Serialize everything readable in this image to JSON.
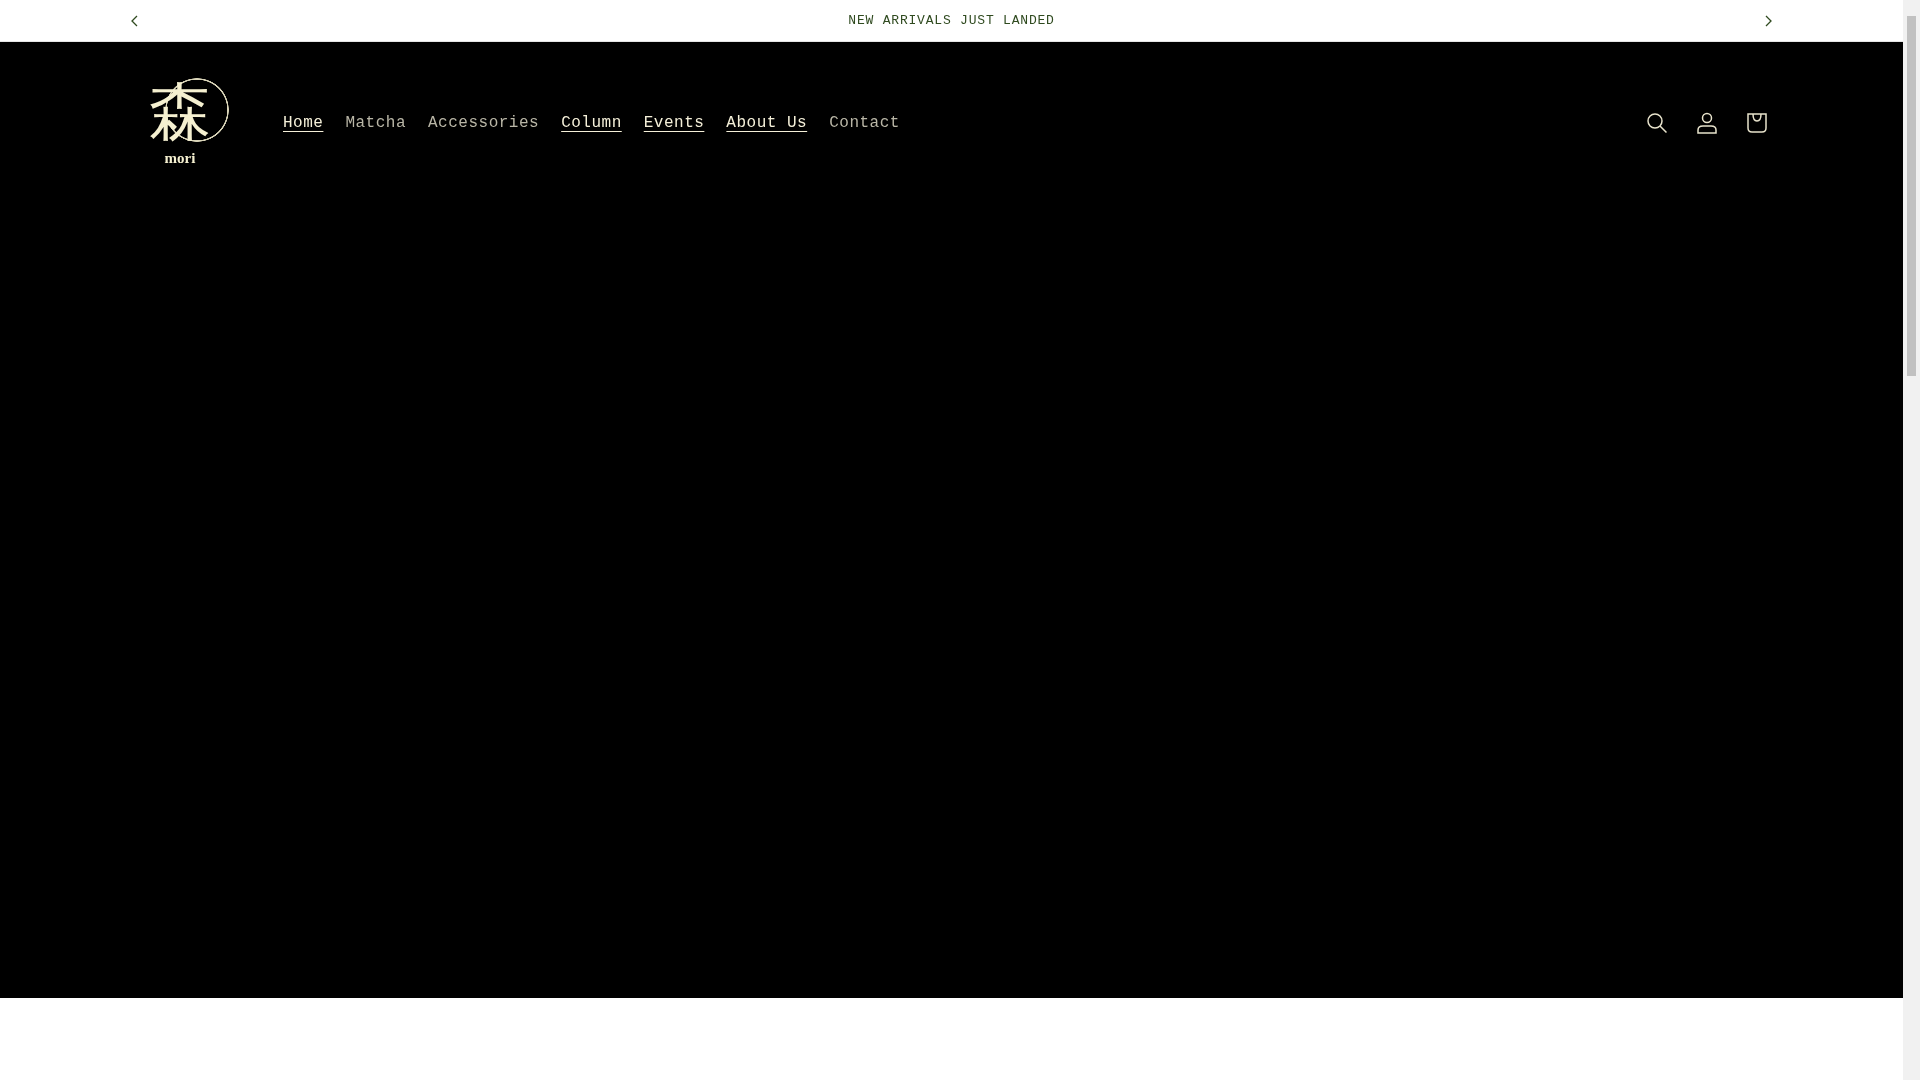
{
  "announcement": {
    "text": "NEW ARRIVALS JUST LANDED"
  },
  "logo": {
    "mark": "森",
    "wordmark": "mori"
  },
  "nav": [
    {
      "label": "Home",
      "underlined": true
    },
    {
      "label": "Matcha",
      "underlined": false
    },
    {
      "label": "Accessories",
      "underlined": false
    },
    {
      "label": "Column",
      "underlined": true
    },
    {
      "label": "Events",
      "underlined": true
    },
    {
      "label": "About Us",
      "underlined": true
    },
    {
      "label": "Contact",
      "underlined": false
    }
  ]
}
